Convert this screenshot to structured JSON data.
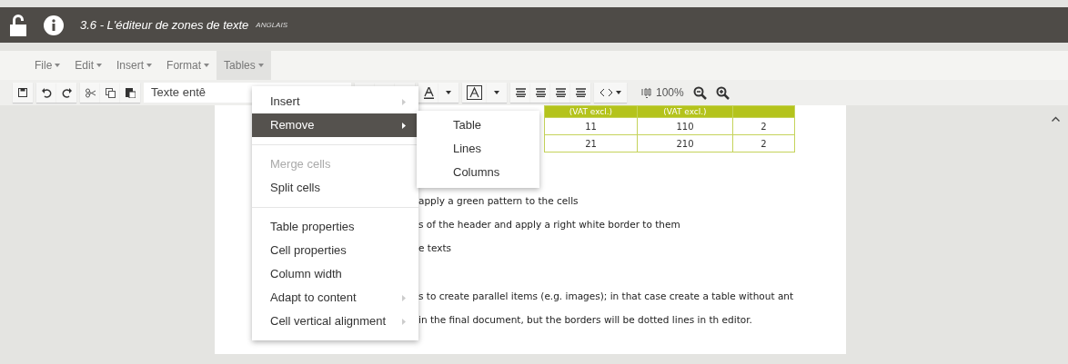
{
  "window": {
    "title": "3.6 - L'éditeur de zones de texte",
    "language": "ANGLAIS"
  },
  "menubar": [
    {
      "label": "File",
      "selected": false
    },
    {
      "label": "Edit",
      "selected": false
    },
    {
      "label": "Insert",
      "selected": false
    },
    {
      "label": "Format",
      "selected": false
    },
    {
      "label": "Tables",
      "selected": true
    }
  ],
  "toolbar": {
    "style_select": "Texte entê",
    "zoom": "100%"
  },
  "tables_menu": [
    {
      "label": "Insert",
      "kind": "submenu",
      "selected": false,
      "disabled": false
    },
    {
      "label": "Remove",
      "kind": "submenu",
      "selected": true,
      "disabled": false
    },
    {
      "kind": "separator"
    },
    {
      "label": "Merge cells",
      "kind": "item",
      "selected": false,
      "disabled": true
    },
    {
      "label": "Split cells",
      "kind": "item",
      "selected": false,
      "disabled": false
    },
    {
      "kind": "separator"
    },
    {
      "label": "Table properties",
      "kind": "item",
      "selected": false,
      "disabled": false
    },
    {
      "label": "Cell properties",
      "kind": "item",
      "selected": false,
      "disabled": false
    },
    {
      "label": "Column width",
      "kind": "item",
      "selected": false,
      "disabled": false
    },
    {
      "label": "Adapt to content",
      "kind": "submenu",
      "selected": false,
      "disabled": false
    },
    {
      "label": "Cell vertical alignment",
      "kind": "submenu",
      "selected": false,
      "disabled": false
    }
  ],
  "remove_submenu": [
    {
      "label": "Table",
      "selected": false
    },
    {
      "label": "Lines",
      "selected": false
    },
    {
      "label": "Columns",
      "selected": false
    }
  ],
  "document": {
    "table": {
      "header": [
        "(VAT excl.)",
        "(VAT excl.)"
      ],
      "rows": [
        [
          "11",
          "110",
          "2"
        ],
        [
          "21",
          "210",
          "2"
        ]
      ]
    },
    "paragraphs": [
      [
        "apply a green pattern to the cells",
        "s of the header and apply a right white border to them",
        "e texts"
      ],
      [
        "s to create parallel items (e.g. images); in that case create a table without ant",
        "in the final document, but the borders will be dotted lines in th editor."
      ]
    ]
  }
}
